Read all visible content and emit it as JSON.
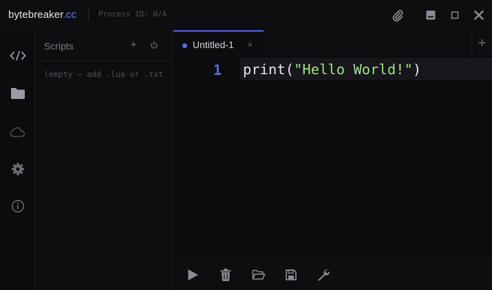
{
  "window": {
    "brand_name": "bytebreaker",
    "brand_tld": ".cc",
    "process_id": "Process ID: N/A"
  },
  "titlebar_actions": [
    "paperclip-icon",
    "minimize-icon",
    "maximize-icon",
    "close-icon"
  ],
  "activity_bar": [
    {
      "icon": "code-icon",
      "active": true
    },
    {
      "icon": "folder-icon",
      "active": false
    },
    {
      "icon": "cloud-icon",
      "active": false
    },
    {
      "icon": "gear-icon",
      "active": false
    },
    {
      "icon": "info-icon",
      "active": false
    }
  ],
  "scripts_panel": {
    "title": "Scripts",
    "add_label": "+",
    "empty_text": "(empty — add .lua or .txt"
  },
  "editor": {
    "tabs": [
      {
        "label": "Untitled-1",
        "close": "×",
        "modified": true
      }
    ],
    "add_tab_label": "+",
    "lines": [
      {
        "number": "1",
        "func": "print(",
        "string": "\"Hello World!\"",
        "end": ")"
      }
    ]
  },
  "bottom_toolbar": [
    "play-icon",
    "trash-icon",
    "folder-open-icon",
    "save-icon",
    "wrench-icon"
  ],
  "colors": {
    "accent": "#5a6be8",
    "string": "#9fe08a",
    "background": "#0c0c0f"
  }
}
